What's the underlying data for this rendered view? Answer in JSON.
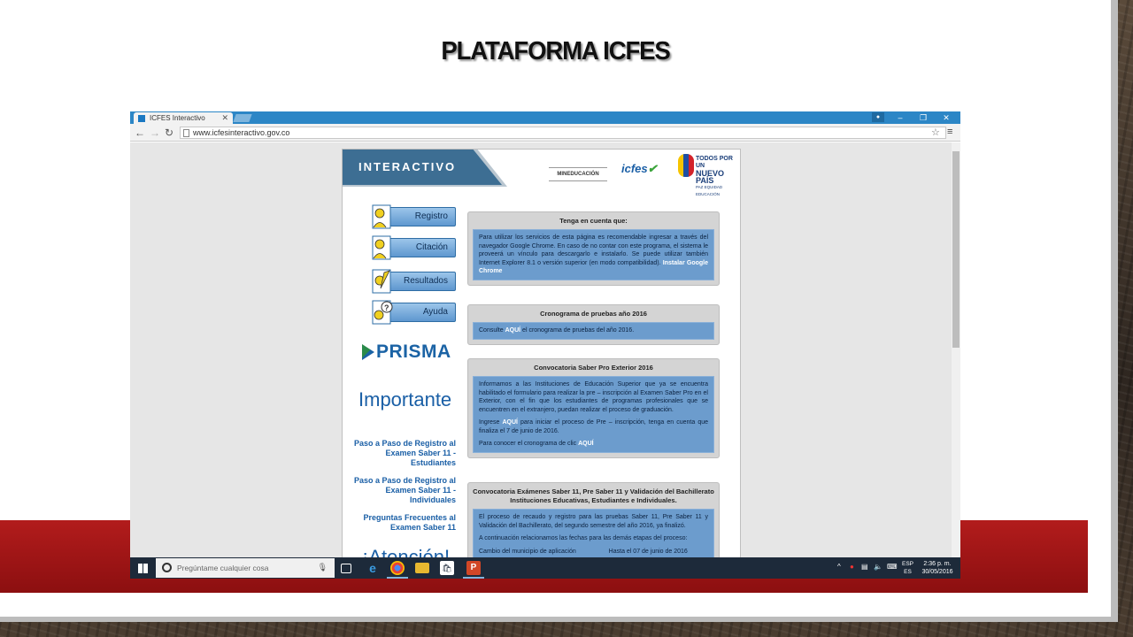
{
  "slide": {
    "title": "PLATAFORMA ICFES"
  },
  "browser": {
    "tab_title": "ICFES Interactivo",
    "url": "www.icfesinteractivo.gov.co"
  },
  "site": {
    "header_text": "INTERACTIVO",
    "logos": {
      "mineducacion": "MINEDUCACIÓN",
      "icfes": "icfes",
      "tpun_line1": "TODOS POR UN",
      "tpun_line2": "NUEVO PAÍS",
      "tpun_line3": "PAZ EQUIDAD EDUCACIÓN"
    },
    "side_buttons": [
      "Registro",
      "Citación",
      "Resultados",
      "Ayuda"
    ],
    "prisma": "PRISMA",
    "important": "Importante",
    "links": [
      "Paso a Paso de Registro al Examen Saber 11 - Estudiantes",
      "Paso a Paso de Registro al Examen Saber 11 - Individuales",
      "Preguntas Frecuentes al Examen Saber 11"
    ],
    "atencion": "¡Atención!"
  },
  "panels": {
    "p1": {
      "title": "Tenga en cuenta que:",
      "text": "Para utilizar los servicios de esta página es recomendable ingresar a través del navegador Google Chrome. En caso de no contar con este programa, el sistema le proveerá un vínculo para descargarlo e instalarlo. Se puede utilizar también Internet Explorer 8.1 o versión superior (en modo compatibilidad).",
      "link": "Instalar Google Chrome"
    },
    "p2": {
      "title": "Cronograma de pruebas año 2016",
      "pre": "Consulte",
      "link": "AQUÍ",
      "post": "el cronograma de pruebas del año 2016."
    },
    "p3": {
      "title": "Convocatoria Saber Pro Exterior 2016",
      "para1": "Informamos a las Instituciones de Educación Superior que ya se encuentra habilitado el formulario para realizar la pre – inscripción al Examen Saber Pro en el Exterior, con el fin que los estudiantes de programas profesionales que se encuentren en el extranjero, puedan realizar el proceso de graduación.",
      "para2_pre": "Ingrese",
      "para2_link": "AQUÍ",
      "para2_post": "para iniciar el proceso de Pre – inscripción, tenga en cuenta que finaliza el 7 de junio de 2016.",
      "para3_pre": "Para conocer el cronograma de clic",
      "para3_link": "AQUÍ"
    },
    "p4": {
      "title": "Convocatoria Exámenes Saber 11, Pre Saber 11 y Validación del Bachillerato Instituciones Educativas, Estudiantes e Individuales.",
      "para1": "El proceso de recaudo y registro para las pruebas Saber 11, Pre Saber 11 y Validación del Bachillerato, del segundo semestre del año 2016, ya finalizó.",
      "para2": "A continuación relacionamos las fechas para las demás etapas del proceso:",
      "para3": "Cambio del municipio de aplicación                   Hasta el 07 de junio de 2016"
    }
  },
  "taskbar": {
    "search_placeholder": "Pregúntame cualquier cosa",
    "lang1": "ESP",
    "lang2": "ES",
    "time": "2:36 p. m.",
    "date": "30/05/2016"
  }
}
